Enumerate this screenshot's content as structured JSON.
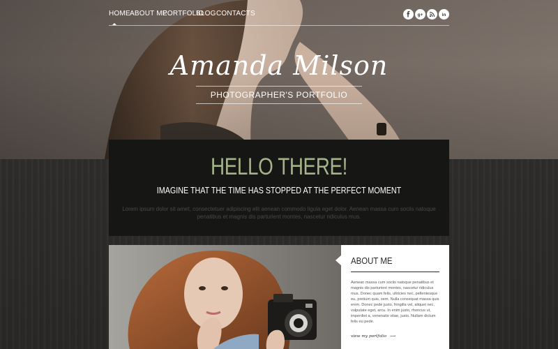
{
  "nav": {
    "items": [
      "HOME",
      "ABOUT ME",
      "PORTFOLIO",
      "BLOG",
      "CONTACTS"
    ],
    "active_index": 0
  },
  "social": [
    {
      "icon": "facebook-icon",
      "glyph": "f"
    },
    {
      "icon": "google-plus-icon",
      "glyph": "g+"
    },
    {
      "icon": "rss-icon",
      "glyph": "rss"
    },
    {
      "icon": "linkedin-icon",
      "glyph": "in"
    }
  ],
  "hero": {
    "title": "Amanda Milson",
    "subtitle": "PHOTOGRAPHER'S PORTFOLIO"
  },
  "hello": {
    "heading": "HELLO THERE!",
    "tagline": "IMAGINE THAT THE TIME HAS STOPPED AT THE PERFECT MOMENT",
    "body": "Lorem ipsum dolor sit amet, consectetuer adipiscing elit aenean commodo ligula eget dolor. Aenean massa cum sociis natoque penatibus et magnis dis parturient montes, nascetur ridiculus mus."
  },
  "about": {
    "title": "ABOUT ME",
    "text": "Aenean massa cum sociis natoque penatibus et magnis dis parturient montes, nascetur ridiculus mus. Donec quam felis, ultricies nec, pellentesque eu, pretium quis, sem. Nulla consequat massa quis enim. Donec pede justo, fringilla vel, aliquet nec, vulputate eget, arcu. In enim justo, rhoncus ut, imperdiet a, venenatis vitae, justo. Nullam dictum felis eu pede.",
    "link": "view my portfolio",
    "link_arrow": "⟶"
  },
  "colors": {
    "accent_green": "#a5b389",
    "panel_dark": "#161615",
    "page_bg": "#2b2a28"
  }
}
